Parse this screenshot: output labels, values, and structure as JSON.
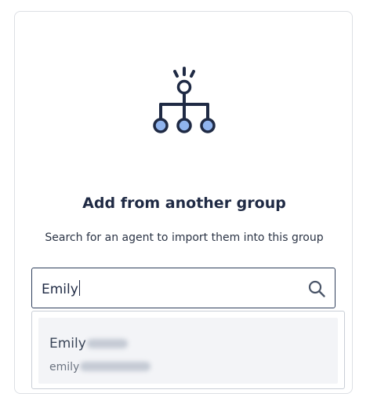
{
  "icons": {
    "hero": "hierarchy-highlight-icon",
    "search": "search-icon"
  },
  "colors": {
    "navy": "#1f2a44",
    "accent_light": "#90b4ee",
    "border": "#dcdfe4",
    "result_bg": "#f3f4f7"
  },
  "dialog": {
    "title": "Add from another group",
    "subtitle": "Search for an agent to import them into this group"
  },
  "search": {
    "value": "Emily"
  },
  "results": [
    {
      "name": "Emily",
      "email": "emily"
    }
  ]
}
